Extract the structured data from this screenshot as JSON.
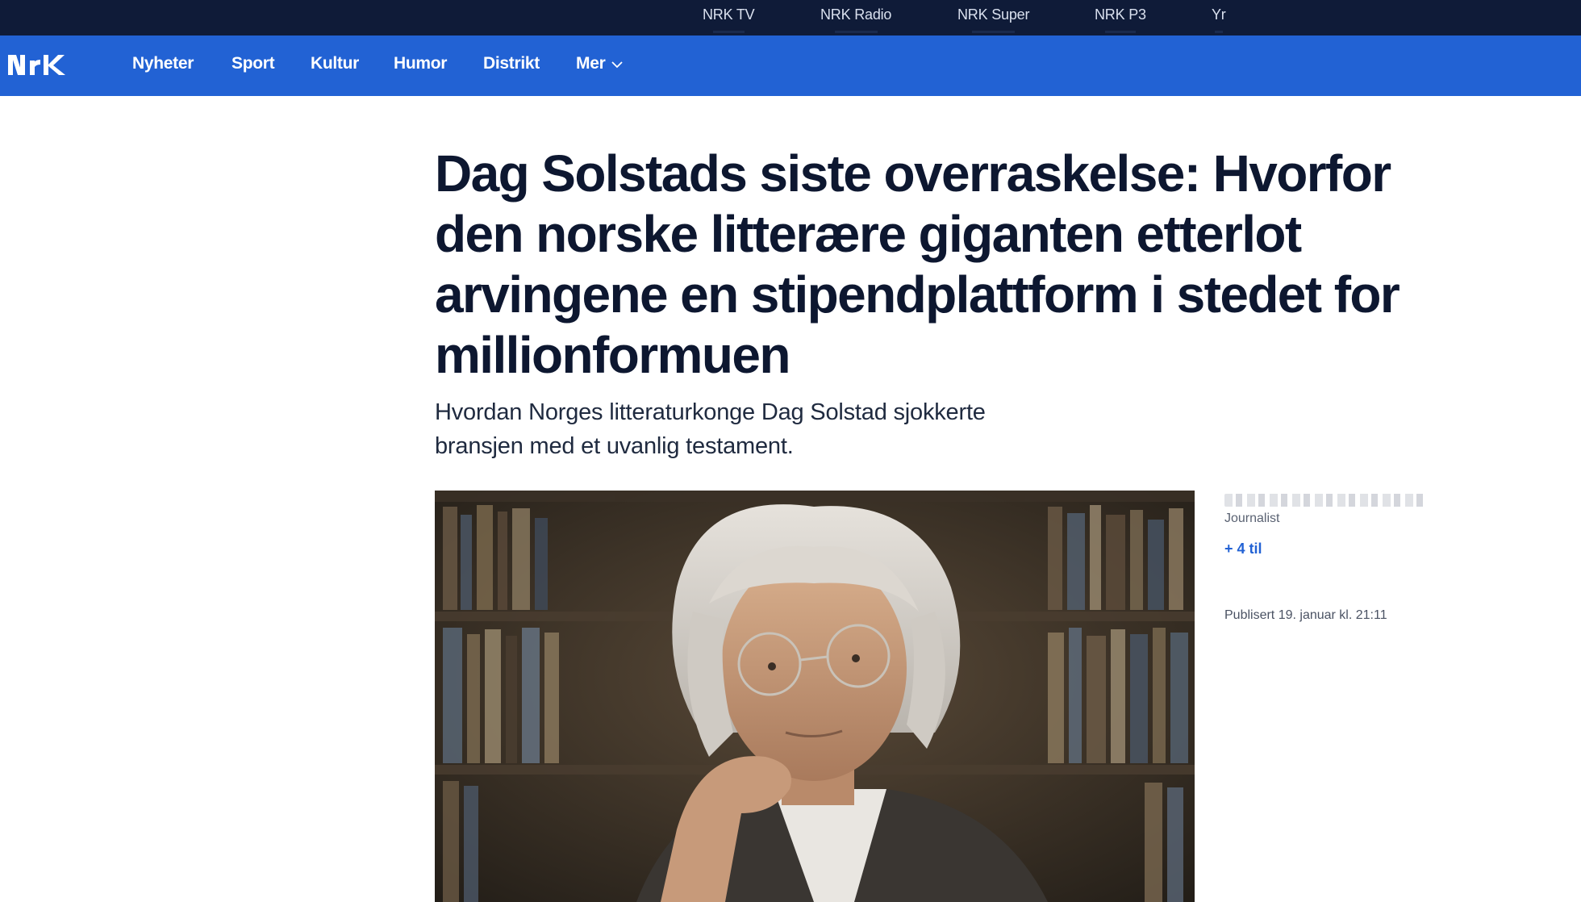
{
  "top_bar": {
    "links": [
      "NRK TV",
      "NRK Radio",
      "NRK Super",
      "NRK P3",
      "Yr"
    ]
  },
  "main_nav": {
    "logo_text": "NRK",
    "items": [
      "Nyheter",
      "Sport",
      "Kultur",
      "Humor",
      "Distrikt",
      "Mer"
    ]
  },
  "article": {
    "headline": "Dag Solstads siste overraskelse: Hvorfor den norske litterære giganten etterlot arvingene en stipendplattform i stedet for millionformuen",
    "lede": "Hvordan Norges litteraturkonge Dag Solstad sjokkerte bransjen med et uvanlig testament.",
    "byline_role": "Journalist",
    "more_authors": "+ 4 til",
    "published": "Publisert 19. januar kl. 21:11"
  },
  "colors": {
    "top_bar": "#0f1b38",
    "nav_bar": "#2262d4",
    "headline": "#0d1730",
    "link": "#2262d4"
  }
}
